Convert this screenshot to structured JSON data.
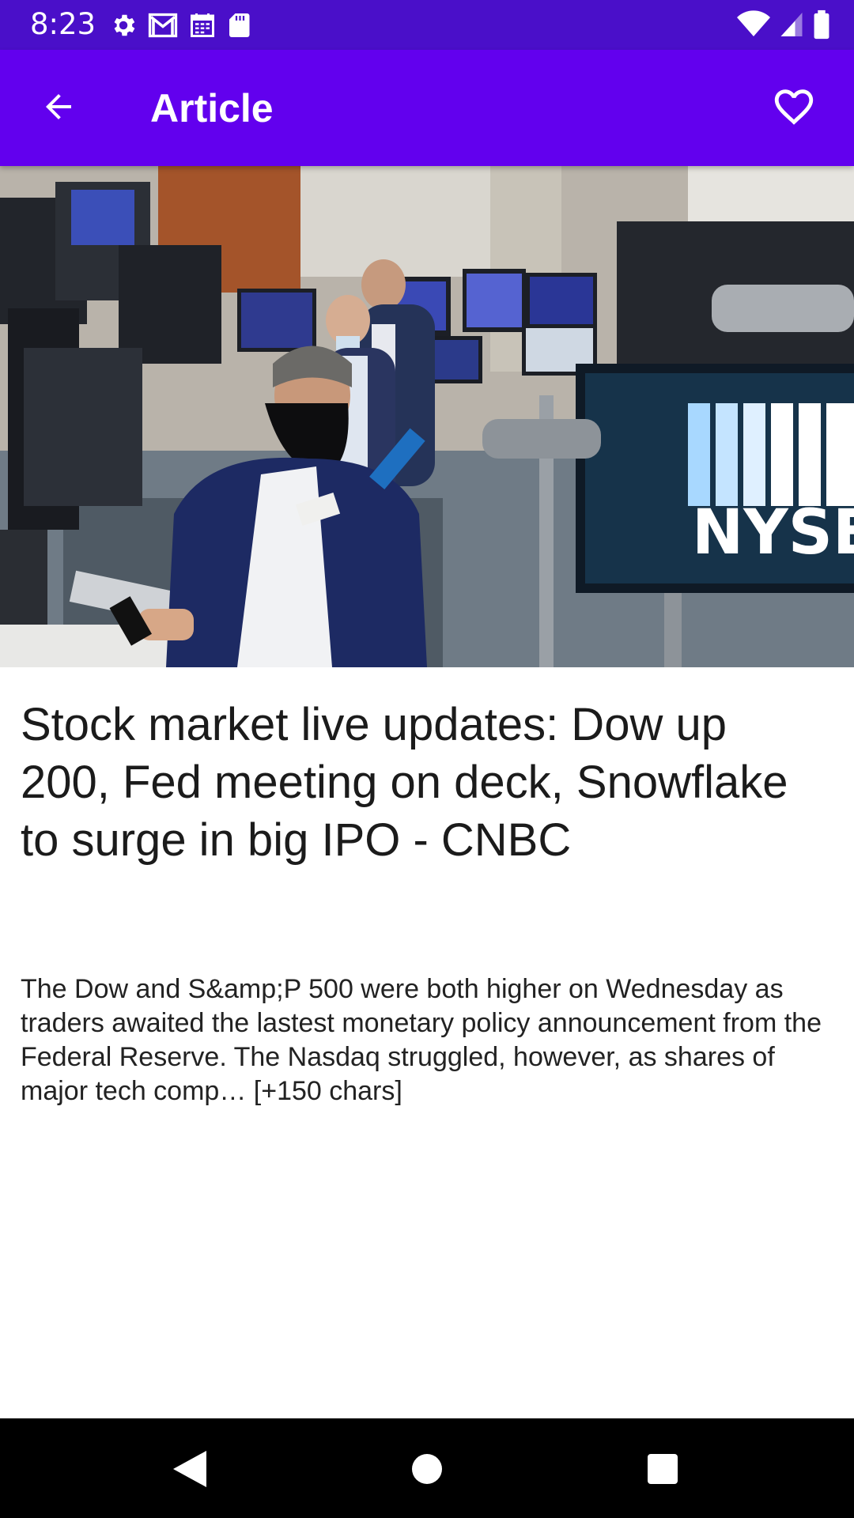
{
  "status_bar": {
    "time": "8:23",
    "left_icons": [
      "settings-icon",
      "gmail-icon",
      "calendar-icon",
      "sd-card-icon"
    ],
    "right_icons": [
      "wifi-icon",
      "cellular-signal-icon",
      "battery-icon"
    ]
  },
  "app_bar": {
    "title": "Article",
    "back_icon": "arrow-back-icon",
    "favorite_icon": "heart-outline-icon"
  },
  "article": {
    "image_text": "NYSE",
    "title": "Stock market live updates: Dow up 200, Fed meeting on deck, Snowflake to surge in big IPO - CNBC",
    "description": "The Dow and S&amp;P 500 were both higher on Wednesday as traders awaited the lastest monetary policy announcement from the Federal Reserve. The Nasdaq struggled, however, as shares of major tech comp… [+150 chars]"
  },
  "nav_bar": {
    "back_icon": "nav-back-icon",
    "home_icon": "nav-home-icon",
    "recents_icon": "nav-recents-icon"
  },
  "colors": {
    "status_bar": "#4a0fc9",
    "app_bar": "#6200ee",
    "background": "#ffffff",
    "nav_bar": "#000000"
  }
}
